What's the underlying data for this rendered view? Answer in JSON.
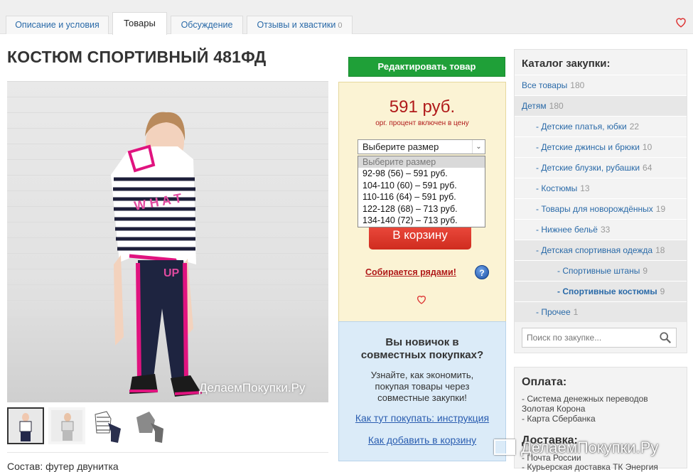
{
  "tabs": [
    {
      "label": "Описание и условия"
    },
    {
      "label": "Товары"
    },
    {
      "label": "Обсуждение"
    },
    {
      "label": "Отзывы и хвастики",
      "count": "0"
    }
  ],
  "product": {
    "title": "КОСТЮМ СПОРТИВНЫЙ 481ФД",
    "watermark": "ДелаемПокупки.Ру",
    "composition": "Состав: футер двунитка"
  },
  "actions": {
    "edit_label": "Редактировать товар",
    "price": "591 руб.",
    "price_note": "орг. процент включен в цену",
    "size_select": "Выберите размер",
    "size_options": [
      "Выберите размер",
      "92-98 (56) – 591 руб.",
      "104-110 (60) – 591 руб.",
      "110-116 (64) – 591 руб.",
      "122-128 (68) – 713 руб.",
      "134-140 (72) – 713 руб."
    ],
    "cart_label": "В корзину",
    "gather_label": "Собирается рядами!",
    "help_label": "?"
  },
  "newbie": {
    "heading": "Вы новичок в совместных покупках?",
    "text": "Узнайте, как экономить, покупая товары через совместные закупки!",
    "link1": "Как тут покупать: инструкция",
    "link2": "Как добавить в корзину"
  },
  "catalog": {
    "heading": "Каталог закупки:",
    "items": [
      {
        "label": "Все товары",
        "count": "180"
      },
      {
        "label": "Детям",
        "count": "180"
      },
      {
        "label": "- Детские платья, юбки",
        "count": "22"
      },
      {
        "label": "- Детские джинсы и брюки",
        "count": "10"
      },
      {
        "label": "- Детские блузки, рубашки",
        "count": "64"
      },
      {
        "label": "- Костюмы",
        "count": "13"
      },
      {
        "label": "- Товары для новорождённых",
        "count": "19"
      },
      {
        "label": "- Нижнее бельё",
        "count": "33"
      },
      {
        "label": "- Детская спортивная одежда",
        "count": "18"
      },
      {
        "label": "- Спортивные штаны",
        "count": "9"
      },
      {
        "label": "- Спортивные костюмы",
        "count": "9"
      },
      {
        "label": "- Прочее",
        "count": "1"
      }
    ],
    "search_placeholder": "Поиск по закупке..."
  },
  "payment": {
    "heading": "Оплата:",
    "line1": "- Система денежных переводов Золотая Корона",
    "line2": "- Карта Сбербанка"
  },
  "delivery": {
    "heading": "Доставка:",
    "line1": "- Почта России",
    "line2": "- Курьерская доставка ТК Энергия"
  },
  "site_watermark": "ДелаемПокупки.Ру",
  "colors": {
    "edit_green": "#1fa038",
    "price_red": "#b01a1a",
    "cart_red": "#d8342a",
    "link_blue": "#2a6aa8"
  }
}
